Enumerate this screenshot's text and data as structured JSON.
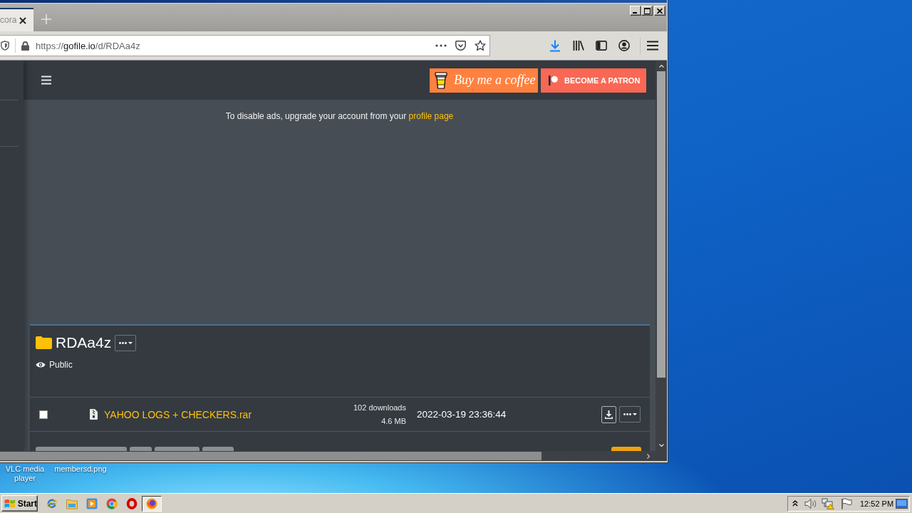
{
  "browser": {
    "tabs": [
      {
        "label": "cora",
        "selected": true
      }
    ],
    "url": {
      "scheme": "https://",
      "host": "gofile.io",
      "path": "/d/RDAa4z"
    }
  },
  "page": {
    "header": {
      "buttons": [
        {
          "kind": "coffee",
          "label": "Buy me a coffee"
        },
        {
          "kind": "patron",
          "label": "BECOME A PATRON"
        }
      ]
    },
    "notice": {
      "text": "To disable ads, upgrade your account from your",
      "link": "profile page"
    },
    "folder": {
      "name": "RDAa4z",
      "visibility": "Public",
      "files": [
        {
          "name": "YAHOO LOGS + CHECKERS.rar",
          "downloads": "102 downloads",
          "size": "4.6 MB",
          "date": "2022-03-19 23:36:44",
          "checked": false
        }
      ]
    }
  },
  "desktop": {
    "icons": [
      {
        "label": "VLC media player"
      },
      {
        "label": "membersd.png"
      }
    ]
  },
  "taskbar": {
    "start": "Start",
    "apps": [
      {
        "kind": "e",
        "selected": false
      },
      {
        "kind": "folder",
        "selected": false
      },
      {
        "kind": "play",
        "selected": false
      },
      {
        "kind": "wheel",
        "selected": false
      },
      {
        "kind": "o",
        "selected": false
      },
      {
        "kind": "fox",
        "selected": true
      }
    ],
    "clock": "12:52 PM"
  }
}
